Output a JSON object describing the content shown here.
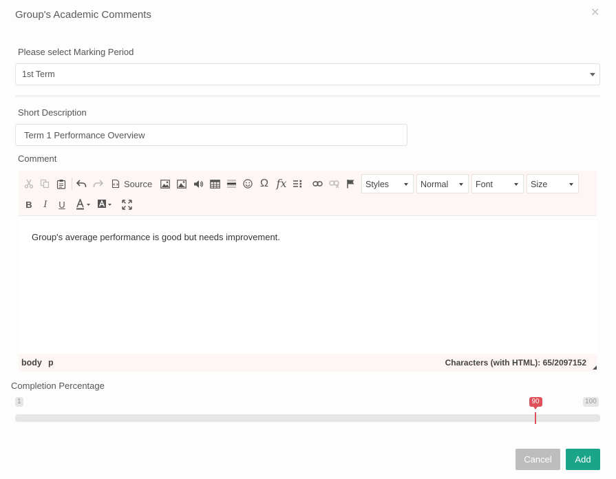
{
  "dialog": {
    "title": "Group's Academic Comments"
  },
  "marking_period": {
    "label": "Please select Marking Period",
    "value": "1st Term"
  },
  "short_description": {
    "label": "Short Description",
    "value": "Term 1 Performance Overview"
  },
  "comment": {
    "label": "Comment",
    "toolbar": {
      "source_label": "Source",
      "styles_label": "Styles",
      "format_label": "Normal",
      "font_label": "Font",
      "size_label": "Size"
    },
    "text": "Group's average performance is good but needs improvement.",
    "path": [
      "body",
      "p"
    ],
    "char_count": "Characters (with HTML): 65/2097152"
  },
  "completion": {
    "label": "Completion Percentage",
    "min": "1",
    "max": "100",
    "value": "90",
    "fraction": 0.9
  },
  "buttons": {
    "cancel": "Cancel",
    "add": "Add"
  },
  "colors": {
    "accent": "#1aa58b",
    "slider_marker": "#e0505a",
    "cancel": "#bdbdbd"
  }
}
